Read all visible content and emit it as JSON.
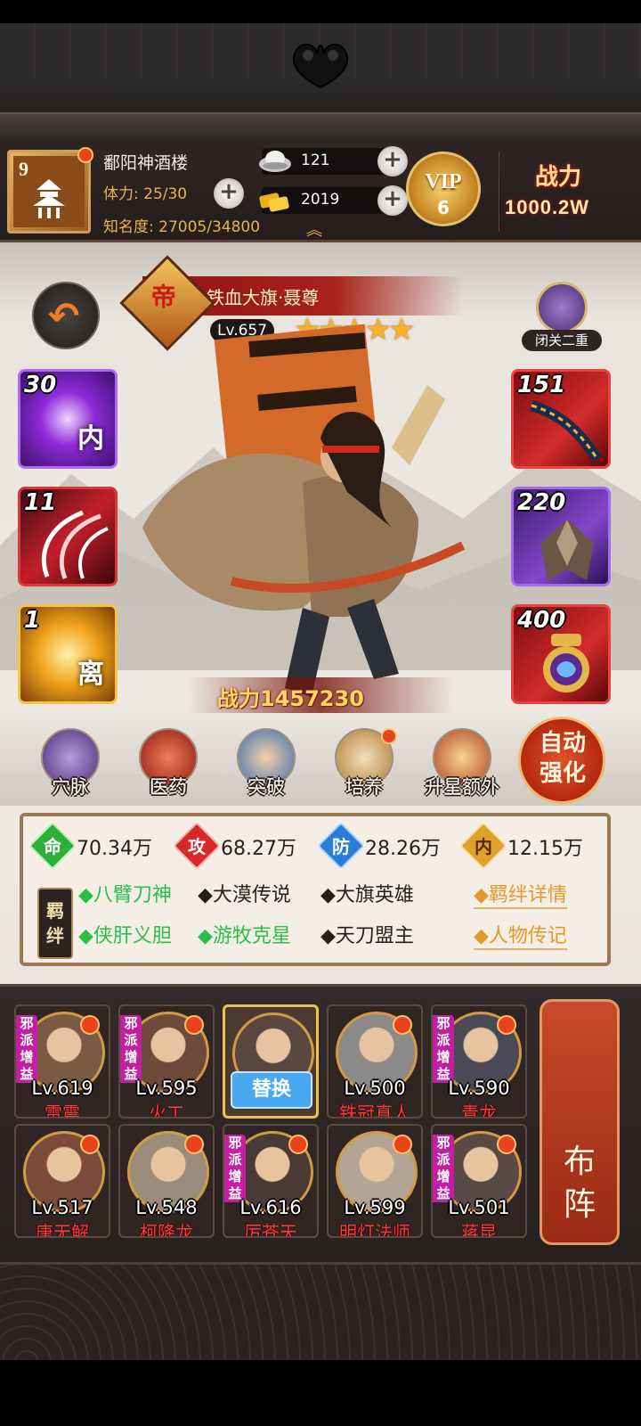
{
  "header": {
    "player_level": "9",
    "player_name": "鄱阳神酒楼",
    "stamina": "体力: 25/30",
    "fame": "知名度: 27005/34800",
    "silver": "121",
    "gold": "2019",
    "vip_label": "VIP",
    "vip_level": "6",
    "power_label": "战力",
    "power_value": "1000.2W"
  },
  "hero": {
    "rank_badge": "帝",
    "title": "铁血大旗·聂尊",
    "level": "Lv.657",
    "stars": 5,
    "power": "战力1457230",
    "seclusion": "闭关二重"
  },
  "skills_left": [
    {
      "count": "30",
      "glyph": "内"
    },
    {
      "count": "11",
      "glyph": ""
    },
    {
      "count": "1",
      "glyph": "离"
    }
  ],
  "skills_right": [
    {
      "count": "151"
    },
    {
      "count": "220"
    },
    {
      "count": "400"
    }
  ],
  "actions": [
    "穴脉",
    "医药",
    "突破",
    "培养",
    "升星额外"
  ],
  "auto_enhance": "自动强化",
  "stats": [
    {
      "icon": "命",
      "value": "70.34万",
      "color": "#2fae3c"
    },
    {
      "icon": "攻",
      "value": "68.27万",
      "color": "#d52a2a"
    },
    {
      "icon": "防",
      "value": "28.26万",
      "color": "#2a7ed5"
    },
    {
      "icon": "内",
      "value": "12.15万",
      "color": "#e0a12a"
    }
  ],
  "bonds": {
    "tag": "羁绊",
    "row1": [
      {
        "text": "◆八臂刀神",
        "active": true
      },
      {
        "text": "◆大漠传说",
        "active": false
      },
      {
        "text": "◆大旗英雄",
        "active": false
      }
    ],
    "row2": [
      {
        "text": "◆侠肝义胆",
        "active": true
      },
      {
        "text": "◆游牧克星",
        "active": true
      },
      {
        "text": "◆天刀盟主",
        "active": false
      }
    ],
    "link_detail": "◆羁绊详情",
    "link_bio": "◆人物传记"
  },
  "roster": {
    "tag_text": "邪派增益",
    "swap_label": "替换",
    "deploy_label": "布阵",
    "cards": [
      {
        "level": "Lv.619",
        "name": "雷震",
        "tag": true
      },
      {
        "level": "Lv.595",
        "name": "火工",
        "tag": true
      },
      {
        "level": "",
        "name": "",
        "tag": false,
        "selected": true
      },
      {
        "level": "Lv.500",
        "name": "铁冠真人",
        "tag": false
      },
      {
        "level": "Lv.590",
        "name": "青龙",
        "tag": true
      },
      {
        "level": "Lv.517",
        "name": "唐无解",
        "tag": false
      },
      {
        "level": "Lv.548",
        "name": "柯降龙",
        "tag": false
      },
      {
        "level": "Lv.616",
        "name": "厉苍天",
        "tag": true
      },
      {
        "level": "Lv.599",
        "name": "明灯法师",
        "tag": false
      },
      {
        "level": "Lv.501",
        "name": "蒋昆",
        "tag": true
      }
    ]
  }
}
